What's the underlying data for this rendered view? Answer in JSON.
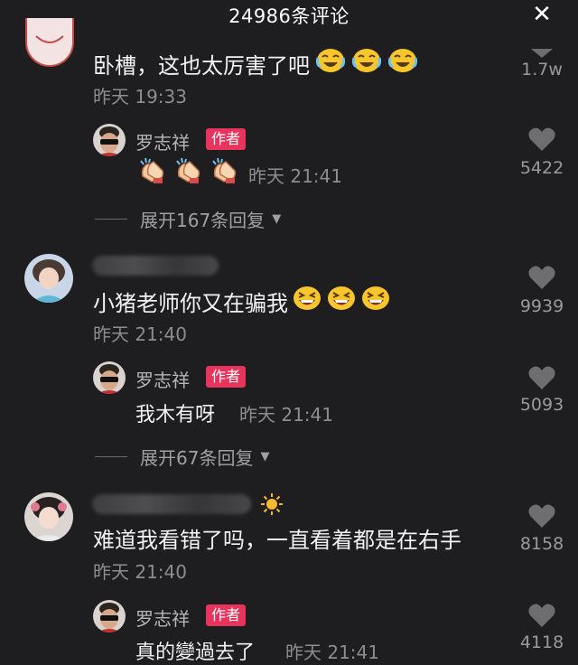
{
  "header": {
    "title": "24986条评论",
    "close_icon": "close-icon"
  },
  "comments": [
    {
      "text": "卧槽，这也太厉害了吧",
      "time": "昨天 19:33",
      "likes": "1.7w",
      "reply": {
        "author": "罗志祥",
        "badge": "作者",
        "text": "",
        "time": "昨天 21:41",
        "likes": "5422"
      },
      "expand_label": "展开167条回复"
    },
    {
      "text": "小猪老师你又在骗我",
      "time": "昨天 21:40",
      "likes": "9939",
      "reply": {
        "author": "罗志祥",
        "badge": "作者",
        "text": "我木有呀",
        "time": "昨天 21:41",
        "likes": "5093"
      },
      "expand_label": "展开67条回复"
    },
    {
      "text": "难道我看错了吗，一直看着都是在右手",
      "time": "昨天 21:40",
      "likes": "8158",
      "reply": {
        "author": "罗志祥",
        "badge": "作者",
        "text": "真的變過去了",
        "time": "昨天 21:41",
        "likes": "4118"
      }
    }
  ],
  "colors": {
    "background": "#1e1d1f",
    "badge": "#e8335c",
    "secondary_text": "#8d8d8f"
  }
}
